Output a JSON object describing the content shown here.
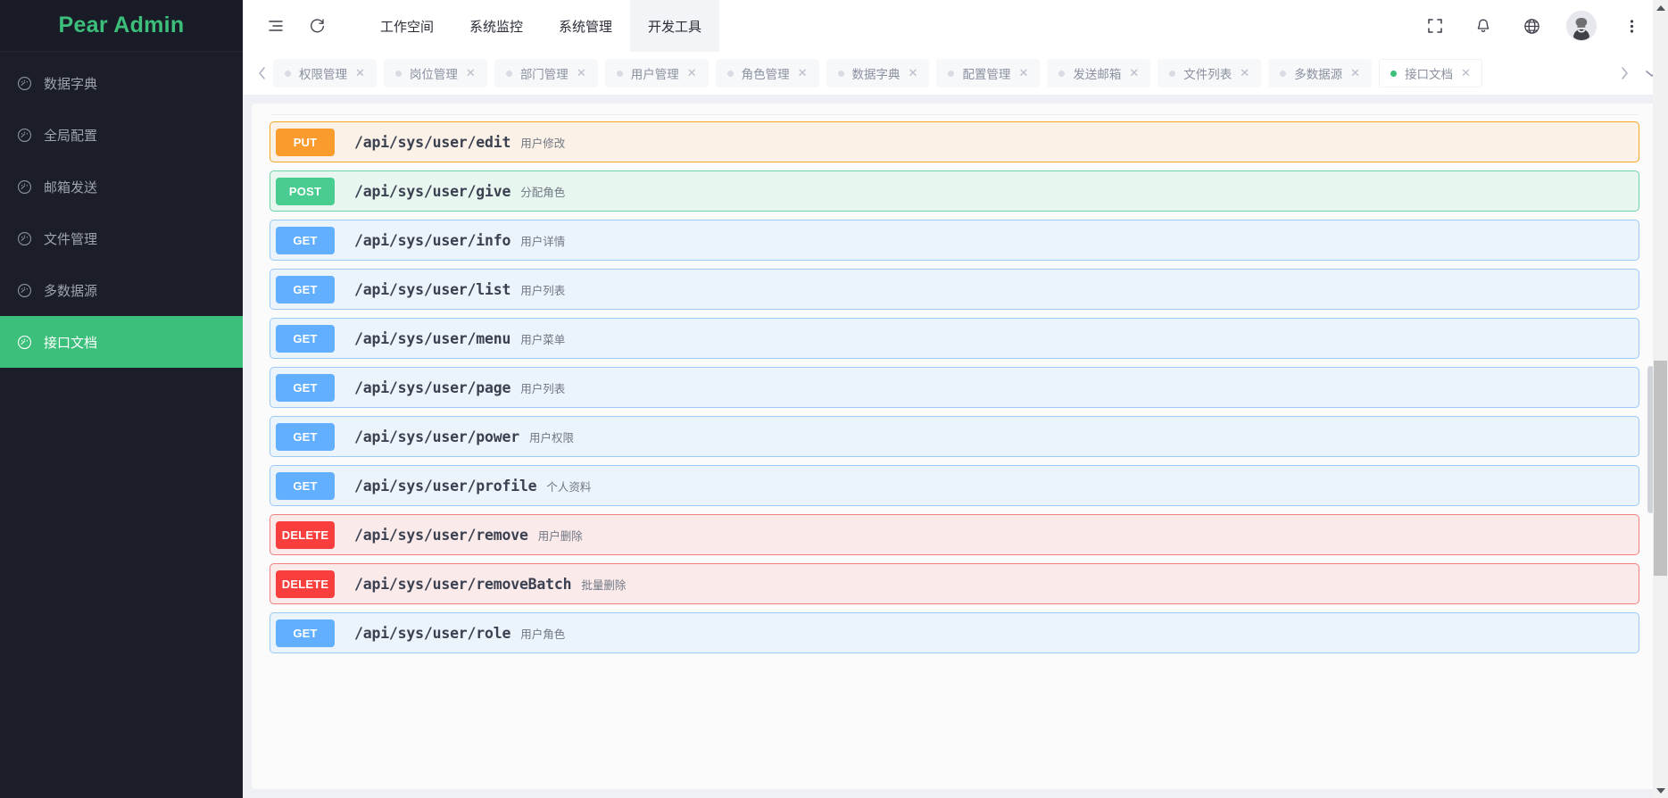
{
  "brand": {
    "title": "Pear Admin",
    "accent": "#3bbf7a"
  },
  "sidebar": {
    "items": [
      {
        "label": "数据字典",
        "icon": "dashboard-icon",
        "active": false
      },
      {
        "label": "全局配置",
        "icon": "dashboard-icon",
        "active": false
      },
      {
        "label": "邮箱发送",
        "icon": "dashboard-icon",
        "active": false
      },
      {
        "label": "文件管理",
        "icon": "dashboard-icon",
        "active": false
      },
      {
        "label": "多数据源",
        "icon": "dashboard-icon",
        "active": false
      },
      {
        "label": "接口文档",
        "icon": "dashboard-icon",
        "active": true
      }
    ]
  },
  "header": {
    "collapse_icon": "menu-collapse-icon",
    "refresh_icon": "refresh-icon",
    "nav": [
      {
        "label": "工作空间",
        "active": false
      },
      {
        "label": "系统监控",
        "active": false
      },
      {
        "label": "系统管理",
        "active": false
      },
      {
        "label": "开发工具",
        "active": true
      }
    ],
    "actions": [
      {
        "icon": "fullscreen-icon"
      },
      {
        "icon": "bell-icon"
      },
      {
        "icon": "globe-icon"
      }
    ],
    "avatar": "user-avatar",
    "more_icon": "more-vertical-icon"
  },
  "tabbar": {
    "prev_icon": "chevron-left-icon",
    "next_icon": "chevron-right-icon",
    "dropdown_icon": "chevron-down-icon",
    "close_glyph": "✕",
    "tabs": [
      {
        "label": "权限管理",
        "active": false
      },
      {
        "label": "岗位管理",
        "active": false
      },
      {
        "label": "部门管理",
        "active": false
      },
      {
        "label": "用户管理",
        "active": false
      },
      {
        "label": "角色管理",
        "active": false
      },
      {
        "label": "数据字典",
        "active": false
      },
      {
        "label": "配置管理",
        "active": false
      },
      {
        "label": "发送邮箱",
        "active": false
      },
      {
        "label": "文件列表",
        "active": false
      },
      {
        "label": "多数据源",
        "active": false
      },
      {
        "label": "接口文档",
        "active": true
      }
    ]
  },
  "api": {
    "rows": [
      {
        "method": "PUT",
        "path": "/api/sys/user/edit",
        "desc": "用户修改"
      },
      {
        "method": "POST",
        "path": "/api/sys/user/give",
        "desc": "分配角色"
      },
      {
        "method": "GET",
        "path": "/api/sys/user/info",
        "desc": "用户详情"
      },
      {
        "method": "GET",
        "path": "/api/sys/user/list",
        "desc": "用户列表"
      },
      {
        "method": "GET",
        "path": "/api/sys/user/menu",
        "desc": "用户菜单"
      },
      {
        "method": "GET",
        "path": "/api/sys/user/page",
        "desc": "用户列表"
      },
      {
        "method": "GET",
        "path": "/api/sys/user/power",
        "desc": "用户权限"
      },
      {
        "method": "GET",
        "path": "/api/sys/user/profile",
        "desc": "个人资料"
      },
      {
        "method": "DELETE",
        "path": "/api/sys/user/remove",
        "desc": "用户删除"
      },
      {
        "method": "DELETE",
        "path": "/api/sys/user/removeBatch",
        "desc": "批量删除"
      },
      {
        "method": "GET",
        "path": "/api/sys/user/role",
        "desc": "用户角色"
      }
    ],
    "colors": {
      "GET": "#61affe",
      "POST": "#49cc90",
      "PUT": "#f99c2d",
      "DELETE": "#f93e3e"
    }
  }
}
